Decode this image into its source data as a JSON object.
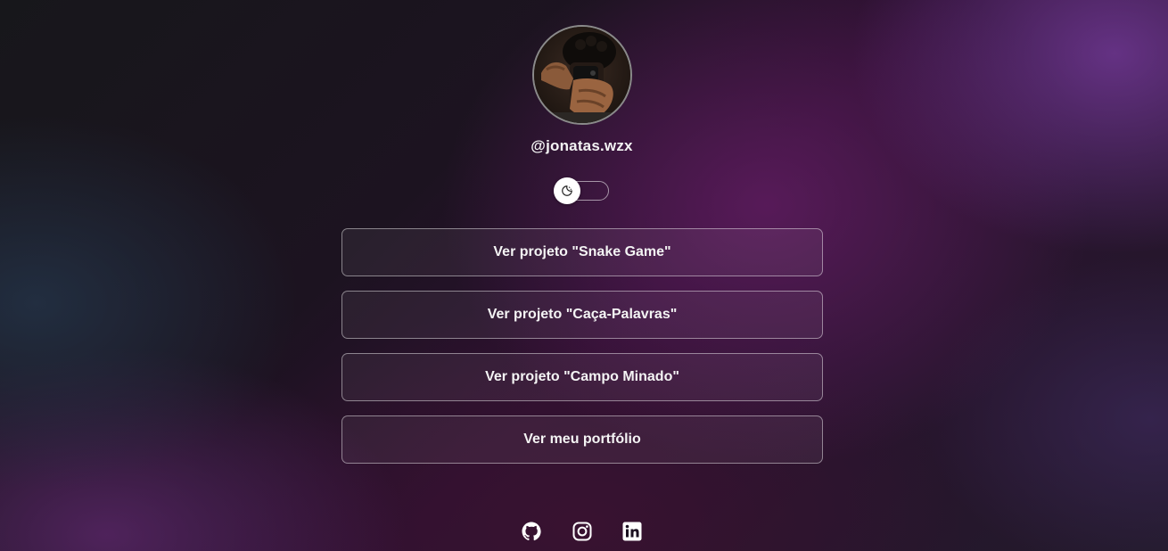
{
  "profile": {
    "username": "@jonatas.wzx",
    "avatar_icon": "profile-photo"
  },
  "theme_toggle": {
    "icon": "moon-icon",
    "state": "dark"
  },
  "links": [
    {
      "label": "Ver projeto \"Snake Game\""
    },
    {
      "label": "Ver projeto \"Caça-Palavras\""
    },
    {
      "label": "Ver projeto \"Campo Minado\""
    },
    {
      "label": "Ver meu portfólio"
    }
  ],
  "socials": [
    {
      "icon": "github-icon"
    },
    {
      "icon": "instagram-icon"
    },
    {
      "icon": "linkedin-icon"
    }
  ],
  "colors": {
    "background_dark": "#17171b",
    "accent_purple": "#5e2d7a",
    "magenta_glow": "#6e206e",
    "button_border": "#a9a2ad",
    "text": "#ffffff"
  }
}
